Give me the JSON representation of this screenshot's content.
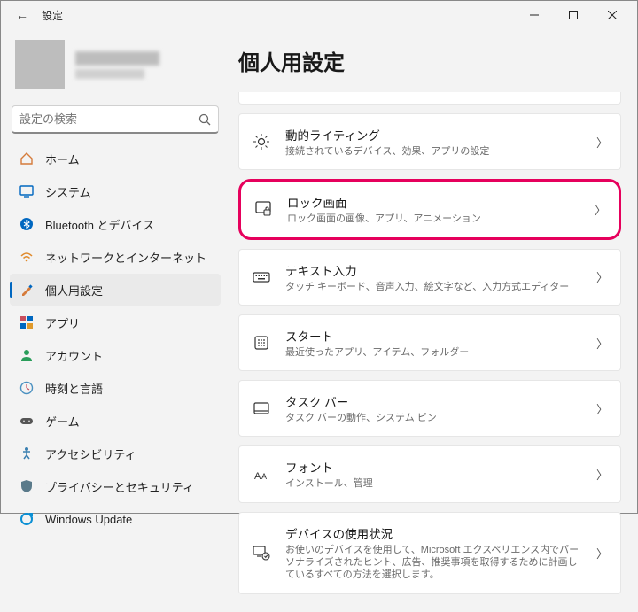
{
  "titlebar": {
    "title": "設定"
  },
  "search": {
    "placeholder": "設定の検索"
  },
  "sidebar": {
    "items": [
      {
        "label": "ホーム"
      },
      {
        "label": "システム"
      },
      {
        "label": "Bluetooth とデバイス"
      },
      {
        "label": "ネットワークとインターネット"
      },
      {
        "label": "個人用設定"
      },
      {
        "label": "アプリ"
      },
      {
        "label": "アカウント"
      },
      {
        "label": "時刻と言語"
      },
      {
        "label": "ゲーム"
      },
      {
        "label": "アクセシビリティ"
      },
      {
        "label": "プライバシーとセキュリティ"
      },
      {
        "label": "Windows Update"
      }
    ]
  },
  "main": {
    "heading": "個人用設定",
    "cards": [
      {
        "title": "動的ライティング",
        "desc": "接続されているデバイス、効果、アプリの設定"
      },
      {
        "title": "ロック画面",
        "desc": "ロック画面の画像、アプリ、アニメーション"
      },
      {
        "title": "テキスト入力",
        "desc": "タッチ キーボード、音声入力、絵文字など、入力方式エディター"
      },
      {
        "title": "スタート",
        "desc": "最近使ったアプリ、アイテム、フォルダー"
      },
      {
        "title": "タスク バー",
        "desc": "タスク バーの動作、システム ピン"
      },
      {
        "title": "フォント",
        "desc": "インストール、管理"
      },
      {
        "title": "デバイスの使用状況",
        "desc": "お使いのデバイスを使用して、Microsoft エクスペリエンス内でパーソナライズされたヒント、広告、推奨事項を取得するために計画しているすべての方法を選択します。"
      }
    ]
  }
}
